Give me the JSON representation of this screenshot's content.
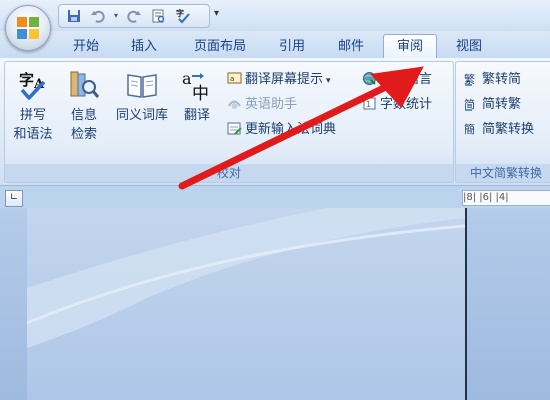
{
  "quick_access": {
    "icons": [
      "save-icon",
      "undo-icon",
      "redo-icon",
      "spelling-icon",
      "customize-icon"
    ]
  },
  "tabs": [
    {
      "label": "开始"
    },
    {
      "label": "插入"
    },
    {
      "label": "页面布局"
    },
    {
      "label": "引用"
    },
    {
      "label": "邮件"
    },
    {
      "label": "审阅",
      "active": true
    },
    {
      "label": "视图"
    }
  ],
  "ribbon": {
    "proofing": {
      "label": "校对",
      "spelling_line1": "拼写",
      "spelling_line2": "和语法",
      "research_line1": "信息",
      "research_line2": "检索",
      "thesaurus": "同义词库",
      "translate": "翻译",
      "translate_tip": "翻译屏幕提示",
      "english_assistant": "英语助手",
      "update_ime": "更新输入法词典",
      "set_language": "设置语言",
      "word_count": "字数统计"
    },
    "chinese_conversion": {
      "label": "中文简繁转换",
      "to_simplified": "繁转简",
      "to_traditional": "简转繁",
      "conversion": "简繁转换"
    }
  },
  "ruler": {
    "ticks": "|8| |6| |4|"
  },
  "colors": {
    "accent": "#15428b",
    "arrow": "#e11b1b",
    "office_orange": "#f28c1e",
    "office_green": "#6fb43f",
    "office_blue": "#3f8fd6",
    "office_yellow": "#f6c531"
  }
}
